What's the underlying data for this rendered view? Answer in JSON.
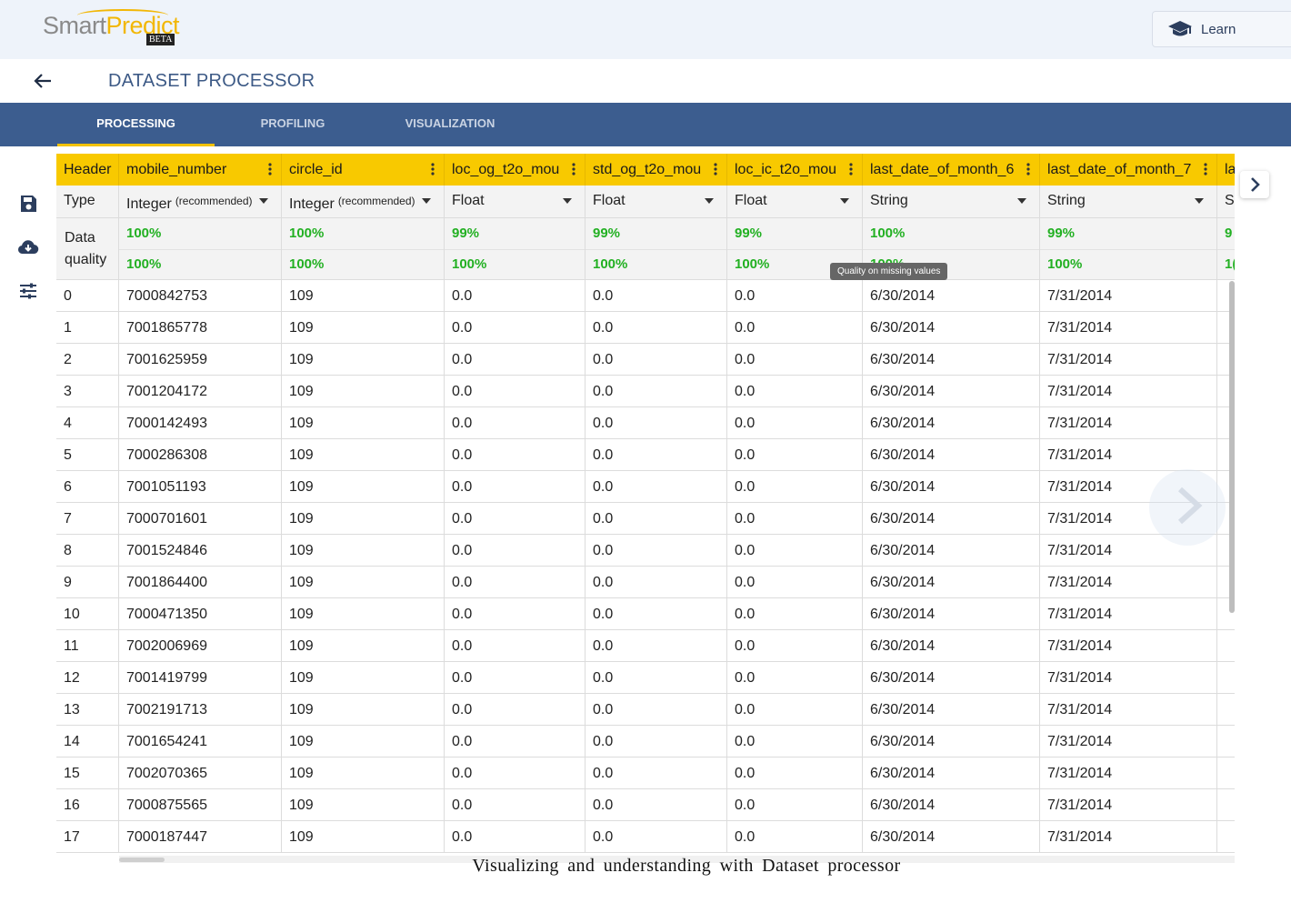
{
  "header": {
    "logo_main": "Smart",
    "logo_accent": "Predict",
    "logo_badge": "BETA",
    "learn_label": "Learn",
    "page_title": "DATASET PROCESSOR"
  },
  "tabs": [
    {
      "label": "PROCESSING",
      "active": true
    },
    {
      "label": "PROFILING",
      "active": false
    },
    {
      "label": "VISUALIZATION",
      "active": false
    }
  ],
  "tools": [
    "save-icon",
    "cloud-download-icon",
    "tune-icon"
  ],
  "grid": {
    "row_header_label": "Header",
    "type_label": "Type",
    "dq_label_1": "Data",
    "dq_label_2": "quality",
    "tooltip": "Quality on missing values",
    "columns": [
      {
        "name": "mobile_number",
        "type": "Integer",
        "recommended": "(recommended)",
        "dq1": "100%",
        "dq2": "100%"
      },
      {
        "name": "circle_id",
        "type": "Integer",
        "recommended": "(recommended)",
        "dq1": "100%",
        "dq2": "100%"
      },
      {
        "name": "loc_og_t2o_mou",
        "type": "Float",
        "recommended": "",
        "dq1": "99%",
        "dq2": "100%"
      },
      {
        "name": "std_og_t2o_mou",
        "type": "Float",
        "recommended": "",
        "dq1": "99%",
        "dq2": "100%"
      },
      {
        "name": "loc_ic_t2o_mou",
        "type": "Float",
        "recommended": "",
        "dq1": "99%",
        "dq2": "100%"
      },
      {
        "name": "last_date_of_month_6",
        "type": "String",
        "recommended": "",
        "dq1": "100%",
        "dq2": "100%"
      },
      {
        "name": "last_date_of_month_7",
        "type": "String",
        "recommended": "",
        "dq1": "99%",
        "dq2": "100%"
      },
      {
        "name": "la",
        "type": "S",
        "recommended": "",
        "dq1": "9",
        "dq2": "1("
      }
    ],
    "rows": [
      [
        "0",
        "7000842753",
        "109",
        "0.0",
        "0.0",
        "0.0",
        "6/30/2014",
        "7/31/2014"
      ],
      [
        "1",
        "7001865778",
        "109",
        "0.0",
        "0.0",
        "0.0",
        "6/30/2014",
        "7/31/2014"
      ],
      [
        "2",
        "7001625959",
        "109",
        "0.0",
        "0.0",
        "0.0",
        "6/30/2014",
        "7/31/2014"
      ],
      [
        "3",
        "7001204172",
        "109",
        "0.0",
        "0.0",
        "0.0",
        "6/30/2014",
        "7/31/2014"
      ],
      [
        "4",
        "7000142493",
        "109",
        "0.0",
        "0.0",
        "0.0",
        "6/30/2014",
        "7/31/2014"
      ],
      [
        "5",
        "7000286308",
        "109",
        "0.0",
        "0.0",
        "0.0",
        "6/30/2014",
        "7/31/2014"
      ],
      [
        "6",
        "7001051193",
        "109",
        "0.0",
        "0.0",
        "0.0",
        "6/30/2014",
        "7/31/2014"
      ],
      [
        "7",
        "7000701601",
        "109",
        "0.0",
        "0.0",
        "0.0",
        "6/30/2014",
        "7/31/2014"
      ],
      [
        "8",
        "7001524846",
        "109",
        "0.0",
        "0.0",
        "0.0",
        "6/30/2014",
        "7/31/2014"
      ],
      [
        "9",
        "7001864400",
        "109",
        "0.0",
        "0.0",
        "0.0",
        "6/30/2014",
        "7/31/2014"
      ],
      [
        "10",
        "7000471350",
        "109",
        "0.0",
        "0.0",
        "0.0",
        "6/30/2014",
        "7/31/2014"
      ],
      [
        "11",
        "7002006969",
        "109",
        "0.0",
        "0.0",
        "0.0",
        "6/30/2014",
        "7/31/2014"
      ],
      [
        "12",
        "7001419799",
        "109",
        "0.0",
        "0.0",
        "0.0",
        "6/30/2014",
        "7/31/2014"
      ],
      [
        "13",
        "7002191713",
        "109",
        "0.0",
        "0.0",
        "0.0",
        "6/30/2014",
        "7/31/2014"
      ],
      [
        "14",
        "7001654241",
        "109",
        "0.0",
        "0.0",
        "0.0",
        "6/30/2014",
        "7/31/2014"
      ],
      [
        "15",
        "7002070365",
        "109",
        "0.0",
        "0.0",
        "0.0",
        "6/30/2014",
        "7/31/2014"
      ],
      [
        "16",
        "7000875565",
        "109",
        "0.0",
        "0.0",
        "0.0",
        "6/30/2014",
        "7/31/2014"
      ],
      [
        "17",
        "7000187447",
        "109",
        "0.0",
        "0.0",
        "0.0",
        "6/30/2014",
        "7/31/2014"
      ]
    ]
  },
  "caption": "Visualizing and understanding with Dataset processor",
  "colors": {
    "brand_blue": "#3c5d8f",
    "accent_yellow": "#f8c900",
    "quality_green": "#22b022"
  }
}
